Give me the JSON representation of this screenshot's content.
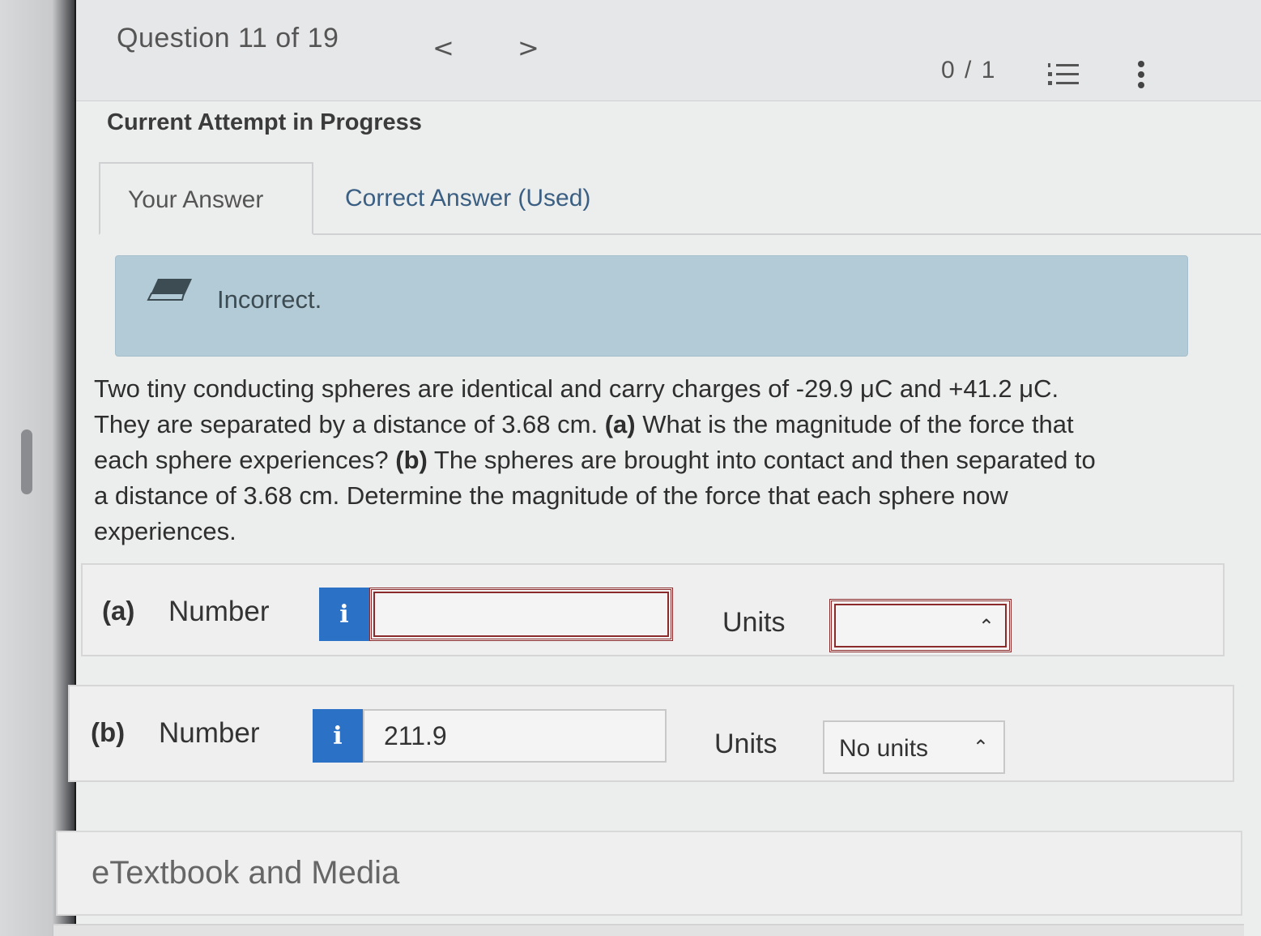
{
  "header": {
    "question_title": "Question 11 of 19",
    "prev_glyph": "<",
    "next_glyph": ">",
    "score": "0 / 1",
    "list_icon": "numbered-list-icon",
    "more_icon": "vertical-dots-icon"
  },
  "attempt_status": "Current Attempt in Progress",
  "tabs": [
    {
      "label": "Your Answer",
      "active": true
    },
    {
      "label": "Correct Answer (Used)",
      "active": false
    }
  ],
  "feedback": {
    "icon": "eraser-icon",
    "text": "Incorrect.",
    "color": "#b2cbd6"
  },
  "question": {
    "line1": "Two tiny conducting spheres are identical and carry charges of -29.9 μC and +41.2 μC.",
    "line2_pre": "They are separated by a distance of 3.68 cm. ",
    "line2_a": "(a)",
    "line2_post": " What is the magnitude of the force that",
    "line3_pre": "each sphere experiences? ",
    "line3_b": "(b)",
    "line3_post": " The spheres are brought into contact and then separated to",
    "line4": "a distance of 3.68 cm. Determine the magnitude of the force that each sphere now",
    "line5": "experiences."
  },
  "parts": [
    {
      "label": "(a)",
      "number_label": "Number",
      "info_glyph": "i",
      "value": "",
      "units_label": "Units",
      "units_value": "",
      "error": true
    },
    {
      "label": "(b)",
      "number_label": "Number",
      "info_glyph": "i",
      "value": "211.9",
      "units_label": "Units",
      "units_value": "No units",
      "error": false
    }
  ],
  "etextbook": "eTextbook and Media",
  "colors": {
    "info_blue": "#2b72c7",
    "error_red": "#8b2a2a",
    "link_blue": "#3a5f82"
  }
}
